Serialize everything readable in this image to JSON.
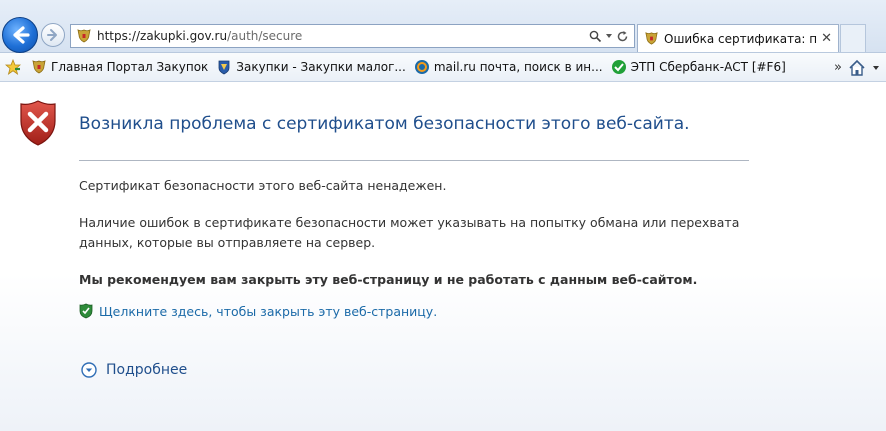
{
  "browser": {
    "address": {
      "scheme": "https://",
      "host": "zakupki.gov.ru",
      "path": "/auth/secure"
    },
    "tab": {
      "title": "Ошибка сертификата: пе..."
    }
  },
  "favorites": {
    "items": [
      {
        "label": "Главная Портал Закупок",
        "icon": "russia-emblem-icon"
      },
      {
        "label": "Закупки - Закупки малог...",
        "icon": "regional-emblem-icon"
      },
      {
        "label": "mail.ru почта, поиск в ин...",
        "icon": "mailru-icon"
      },
      {
        "label": "ЭТП Сбербанк-АСТ [#F6]",
        "icon": "sberbank-icon"
      }
    ],
    "overflow": "»"
  },
  "page": {
    "headline": "Возникла проблема с сертификатом безопасности этого веб-сайта.",
    "cert_untrusted": "Сертификат безопасности этого веб-сайта ненадежен.",
    "warning_text": "Наличие ошибок в сертификате безопасности может указывать на попытку обмана или перехвата данных, которые вы отправляете на сервер.",
    "recommendation": "Мы рекомендуем вам закрыть эту веб-страницу и не работать с данным веб-сайтом.",
    "close_link": "Щелкните здесь, чтобы закрыть эту веб-страницу.",
    "more_info": "Подробнее"
  },
  "colors": {
    "headline": "#1f4e8c",
    "link": "#1b6aa8",
    "error_shield": "#c62828",
    "safe_shield": "#2e8b3a"
  }
}
